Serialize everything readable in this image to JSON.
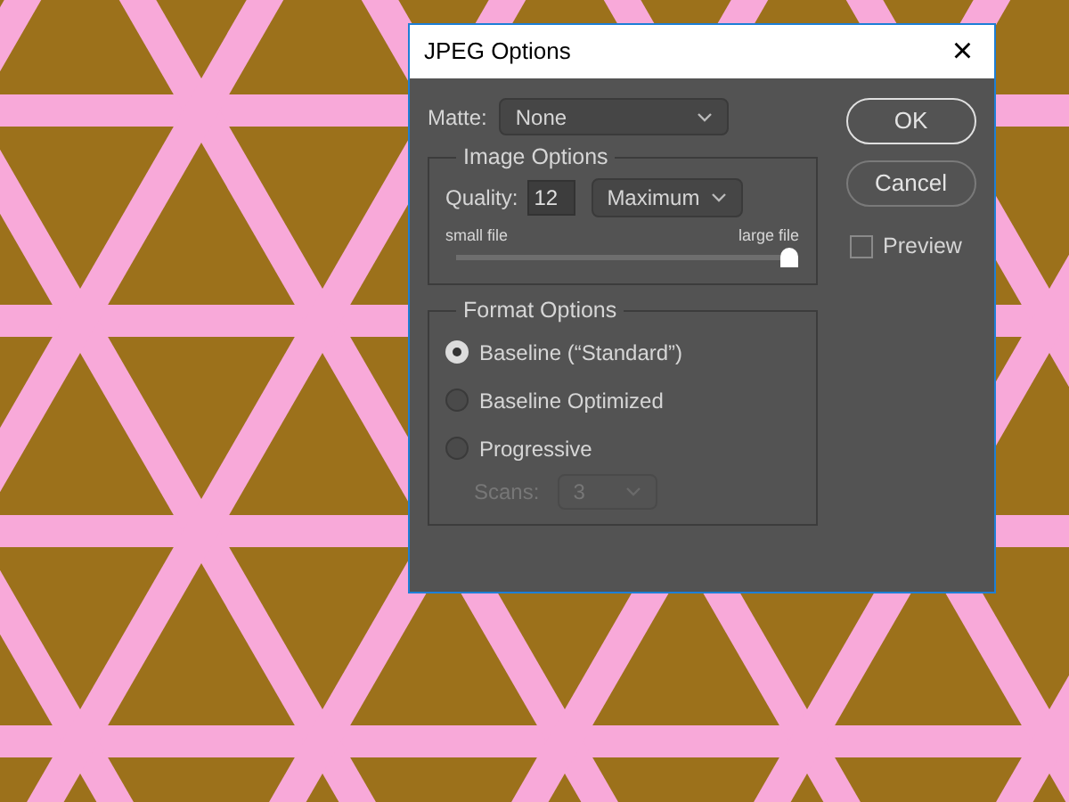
{
  "window": {
    "title": "JPEG Options",
    "close": "×"
  },
  "matte": {
    "label": "Matte:",
    "value": "None"
  },
  "image_options": {
    "title": "Image Options",
    "quality_label": "Quality:",
    "quality_value": "12",
    "quality_preset": "Maximum",
    "slider_min_label": "small file",
    "slider_max_label": "large file",
    "level": 1
  },
  "format_options": {
    "title": "Format Options",
    "choices": [
      {
        "label": "Baseline (“Standard”)",
        "selected": true
      },
      {
        "label": "Baseline Optimized",
        "selected": false
      },
      {
        "label": "Progressive",
        "selected": false
      }
    ],
    "scans": {
      "label": "Scans:",
      "value": "3",
      "disabled": true
    }
  },
  "buttons": [
    {
      "label": "OK",
      "default": true
    },
    {
      "label": "Cancel",
      "default": false
    }
  ],
  "preview": {
    "label": "Preview",
    "checked": false
  }
}
